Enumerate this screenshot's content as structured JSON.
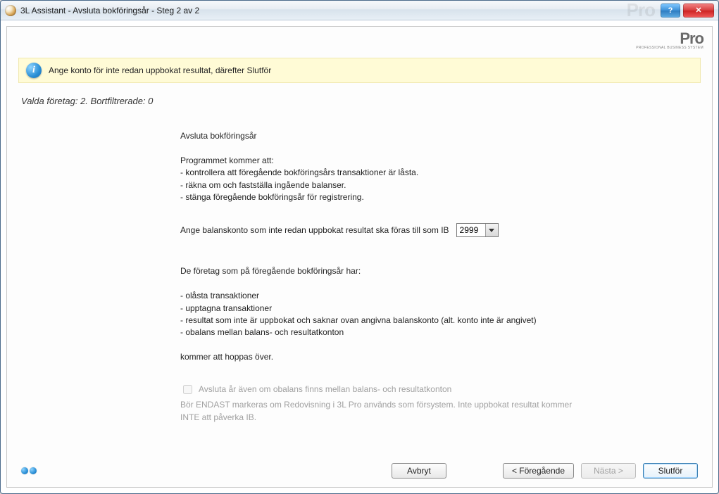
{
  "window": {
    "title": "3L Assistant - Avsluta bokföringsår - Steg 2 av 2",
    "help_glyph": "?",
    "close_glyph": "✕"
  },
  "brand": {
    "name": "Pro",
    "sub": "PROFESSIONAL BUSINESS SYSTEM"
  },
  "info": {
    "icon_glyph": "i",
    "text": "Ange konto för inte redan uppbokat resultat, därefter Slutför"
  },
  "status": "Valda företag: 2. Bortfiltrerade: 0",
  "content": {
    "heading": "Avsluta bokföringsår",
    "intro": "Programmet kommer att:",
    "bullets": [
      " - kontrollera att föregående bokföringsårs transaktioner är låsta.",
      " - räkna om och fastställa ingående balanser.",
      " - stänga föregående bokföringsår för registrering."
    ],
    "select_label": "Ange balanskonto som inte redan uppbokat resultat ska föras till som IB",
    "select_value": "2999",
    "warn_intro": "De företag som på föregående bokföringsår har:",
    "warn_items": [
      "- olåsta transaktioner",
      "- upptagna transaktioner",
      "- resultat som inte är uppbokat och saknar ovan angivna balanskonto (alt. konto inte är angivet)",
      "- obalans mellan balans- och resultatkonton"
    ],
    "warn_outro": "kommer att hoppas över.",
    "checkbox_label": "Avsluta år även om obalans finns mellan balans- och resultatkonton",
    "checkbox_note": "Bör ENDAST markeras om Redovisning i 3L Pro används som försystem. Inte uppbokat resultat kommer INTE att påverka IB."
  },
  "footer": {
    "cancel": "Avbryt",
    "back": "< Föregående",
    "next": "Nästa >",
    "finish": "Slutför"
  }
}
